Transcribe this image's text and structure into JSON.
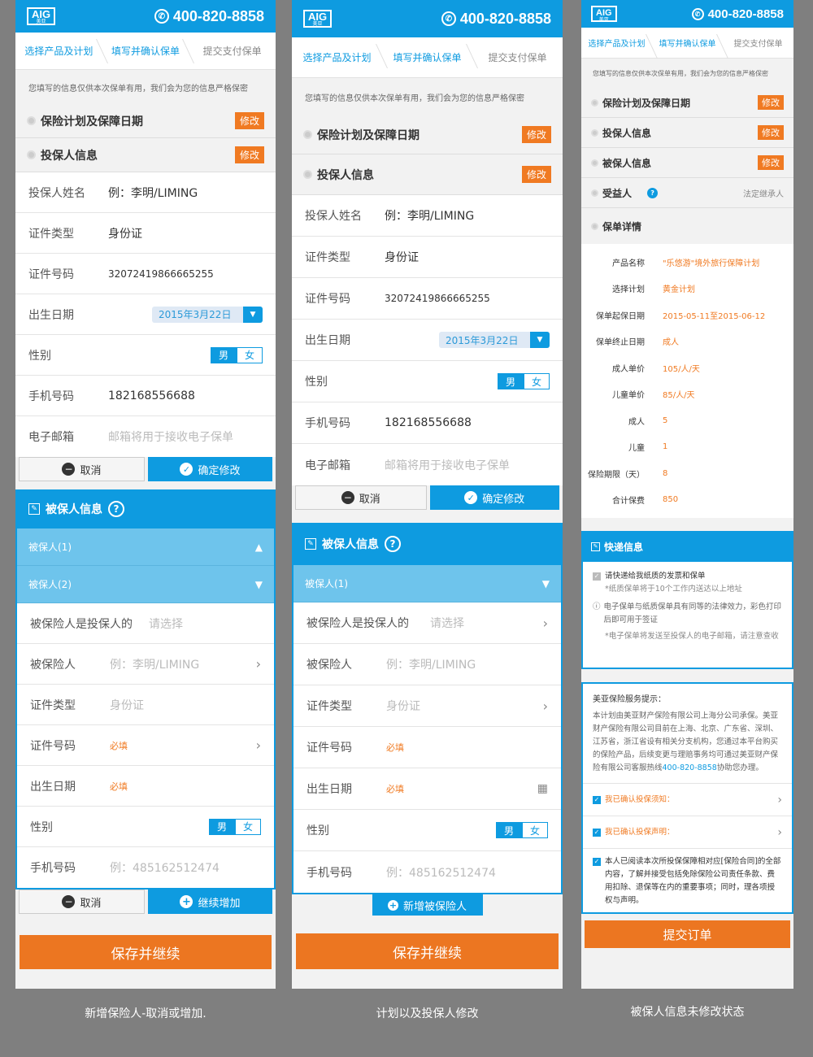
{
  "header": {
    "logo": "AIG",
    "logo_sub": "美亚",
    "phone": "400-820-8858"
  },
  "steps": [
    "选择产品及计划",
    "填写并确认保单",
    "提交支付保单"
  ],
  "notice": "您填写的信息仅供本次保单有用，我们会为您的信息严格保密",
  "sections": {
    "plan": "保险计划及保障日期",
    "holder": "投保人信息",
    "insured": "被保人信息",
    "beneficiary": "受益人",
    "policy_detail": "保单详情",
    "express": "快递信息"
  },
  "edit_label": "修改",
  "holder_form": {
    "name_label": "投保人姓名",
    "name_value": "例：李明/LIMING",
    "idtype_label": "证件类型",
    "idtype_value": "身份证",
    "idno_label": "证件号码",
    "idno_value": "32072419866665255",
    "dob_label": "出生日期",
    "dob_value": "2015年3月22日",
    "sex_label": "性别",
    "male": "男",
    "female": "女",
    "phone_label": "手机号码",
    "phone_value": "182168556688",
    "email_label": "电子邮箱",
    "email_placeholder": "邮箱将用于接收电子保单"
  },
  "buttons": {
    "cancel": "取消",
    "confirm": "确定修改",
    "continue_add": "继续增加",
    "add_insured": "新增被保险人",
    "save_continue": "保存并继续",
    "submit_order": "提交订单"
  },
  "insured_form": {
    "insured1": "被保人(1)",
    "insured2": "被保人(2)",
    "relation_label": "被保险人是投保人的",
    "relation_placeholder": "请选择",
    "insured_label": "被保险人",
    "insured_placeholder": "例：李明/LIMING",
    "idtype_label": "证件类型",
    "idtype_placeholder": "身份证",
    "idno_label": "证件号码",
    "required": "必填",
    "dob_label": "出生日期",
    "sex_label": "性别",
    "phone_label": "手机号码",
    "phone_placeholder": "例：485162512474"
  },
  "beneficiary_value": "法定继承人",
  "policy_detail": [
    {
      "k": "产品名称",
      "v": "\"乐悠游\"境外旅行保障计划"
    },
    {
      "k": "选择计划",
      "v": "黄金计划"
    },
    {
      "k": "保单起保日期",
      "v": "2015-05-11至2015-06-12"
    },
    {
      "k": "保单终止日期",
      "v": "成人"
    },
    {
      "k": "成人单价",
      "v": "105/人/天"
    },
    {
      "k": "儿童单价",
      "v": "85/人/天"
    },
    {
      "k": "成人",
      "v": "5"
    },
    {
      "k": "儿童",
      "v": "1"
    },
    {
      "k": "保险期限（天）",
      "v": "8"
    },
    {
      "k": "合计保费",
      "v": "850"
    }
  ],
  "express": {
    "opt": "请快递给我纸质的发票和保单",
    "note1": "*纸质保单将于10个工作内送达以上地址",
    "note2": "电子保单与纸质保单具有同等的法律效力，彩色打印后即可用于签证",
    "note3": "*电子保单将发送至投保人的电子邮箱，请注意查收"
  },
  "service": {
    "title": "美亚保险服务提示：",
    "body": "本计划由美亚财产保险有限公司上海分公司承保。美亚财产保险有限公司目前在上海、北京、广东省、深圳、江苏省，浙江省设有相关分支机构，您通过本平台购买的保险产品，后续变更与理赔事务均可通过美亚财产保险有限公司客服热线",
    "hotline": "400-820-8858",
    "tail": "协助您办理。",
    "confirm1": "我已确认投保须知：",
    "confirm2": "我已确认投保声明：",
    "agree": "本人已阅读本次所投保保障相对应[保险合同]的全部内容，了解并接受包括免除保险公司责任条款、费用扣除、退保等在内的重要事项；同时，理各项授权与声明。"
  },
  "captions": [
    "新增保险人-取消或增加.",
    "计划以及投保人修改",
    "被保人信息未修改状态"
  ]
}
